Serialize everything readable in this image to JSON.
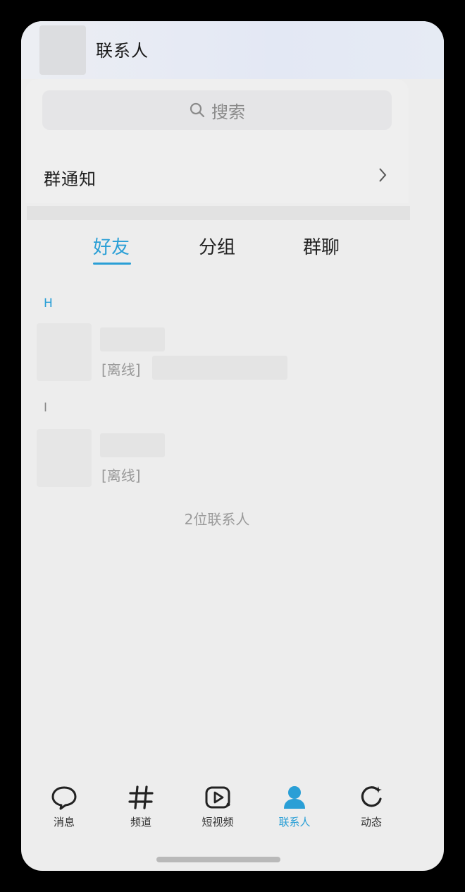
{
  "header": {
    "title": "联系人"
  },
  "search": {
    "placeholder": "搜索"
  },
  "group_notice": {
    "label": "群通知"
  },
  "tabs": [
    {
      "label": "好友",
      "active": true
    },
    {
      "label": "分组",
      "active": false
    },
    {
      "label": "群聊",
      "active": false
    }
  ],
  "sections": [
    {
      "letter": "H",
      "contacts": [
        {
          "status": "[离线]"
        }
      ]
    },
    {
      "letter": "I",
      "contacts": [
        {
          "status": "[离线]"
        }
      ]
    }
  ],
  "contacts_count": "2位联系人",
  "navbar": {
    "items": [
      {
        "label": "消息",
        "icon": "chat-bubble-icon"
      },
      {
        "label": "频道",
        "icon": "hash-icon"
      },
      {
        "label": "短视频",
        "icon": "video-icon"
      },
      {
        "label": "联系人",
        "icon": "person-icon",
        "active": true
      },
      {
        "label": "动态",
        "icon": "refresh-star-icon"
      }
    ]
  },
  "colors": {
    "accent": "#2a9fd6",
    "background": "#ededed"
  }
}
